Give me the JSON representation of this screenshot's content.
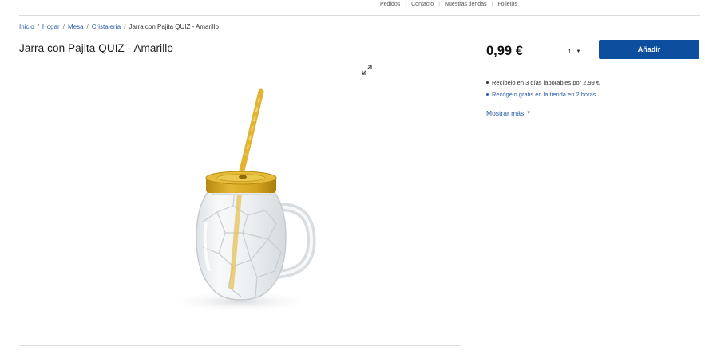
{
  "top_nav": {
    "items": [
      "Pedidos",
      "Contacto",
      "Nuestras tiendas",
      "Folletos"
    ],
    "separator": "|"
  },
  "breadcrumb": {
    "items": [
      "Inicio",
      "Hogar",
      "Mesa",
      "Cristalería"
    ],
    "separator": "/",
    "current": "Jarra con Pajita QUIZ - Amarillo"
  },
  "product": {
    "title": "Jarra con Pajita QUIZ - Amarillo",
    "image_icon": "mason-jar-with-straw",
    "expand_icon": "expand-arrows-icon"
  },
  "buy_box": {
    "price": "0,99 €",
    "quantity": "1",
    "add_label": "Añadir",
    "accent_color": "#0d4f9e"
  },
  "delivery": {
    "home": "Recíbelo en 3 días laborables por 2,99 €",
    "store": "Recógelo gratis en la tienda en 2 horas"
  },
  "show_more": {
    "label": "Mostrar más",
    "icon": "chevron-down-icon"
  }
}
